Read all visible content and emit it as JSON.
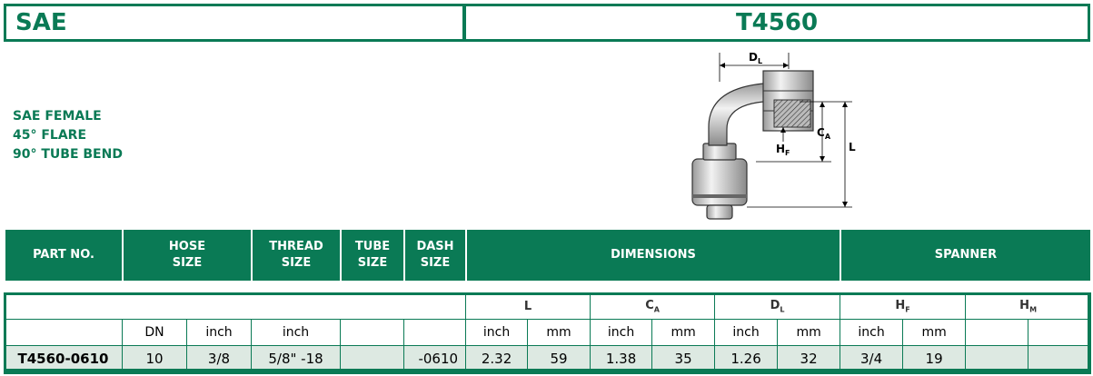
{
  "header": {
    "series": "SAE",
    "part": "T4560"
  },
  "description": {
    "line1": "SAE FEMALE",
    "line2": "45° FLARE",
    "line3": "90° TUBE BEND"
  },
  "diagram": {
    "label_dl": "D",
    "label_dl_sub": "L",
    "label_ca": "C",
    "label_ca_sub": "A",
    "label_hf": "H",
    "label_hf_sub": "F",
    "label_l": "L"
  },
  "table_header": {
    "part_no": "PART NO.",
    "hose_size_1": "HOSE",
    "hose_size_2": "SIZE",
    "thread_size_1": "THREAD",
    "thread_size_2": "SIZE",
    "tube_size_1": "TUBE",
    "tube_size_2": "SIZE",
    "dash_size_1": "DASH",
    "dash_size_2": "SIZE",
    "dimensions": "DIMENSIONS",
    "spanner": "SPANNER"
  },
  "dims_header": {
    "l": "L",
    "ca": "C",
    "ca_sub": "A",
    "dl": "D",
    "dl_sub": "L",
    "hf": "H",
    "hf_sub": "F",
    "hm": "H",
    "hm_sub": "M"
  },
  "units": {
    "dn": "DN",
    "hose_inch": "inch",
    "thread_inch": "inch",
    "l_inch": "inch",
    "l_mm": "mm",
    "ca_inch": "inch",
    "ca_mm": "mm",
    "dl_inch": "inch",
    "dl_mm": "mm",
    "hf_inch": "inch",
    "hf_mm": "mm"
  },
  "row": {
    "part_no": "T4560-0610",
    "dn": "10",
    "hose_inch": "3/8",
    "thread": "5/8\" -18",
    "tube": "",
    "dash": "-0610",
    "l_inch": "2.32",
    "l_mm": "59",
    "ca_inch": "1.38",
    "ca_mm": "35",
    "dl_inch": "1.26",
    "dl_mm": "32",
    "hf_inch": "3/4",
    "hf_mm": "19",
    "hm_inch": "",
    "hm_mm": ""
  },
  "colors": {
    "brand_green": "#0a7a55",
    "row_fill": "#dde9e2"
  }
}
